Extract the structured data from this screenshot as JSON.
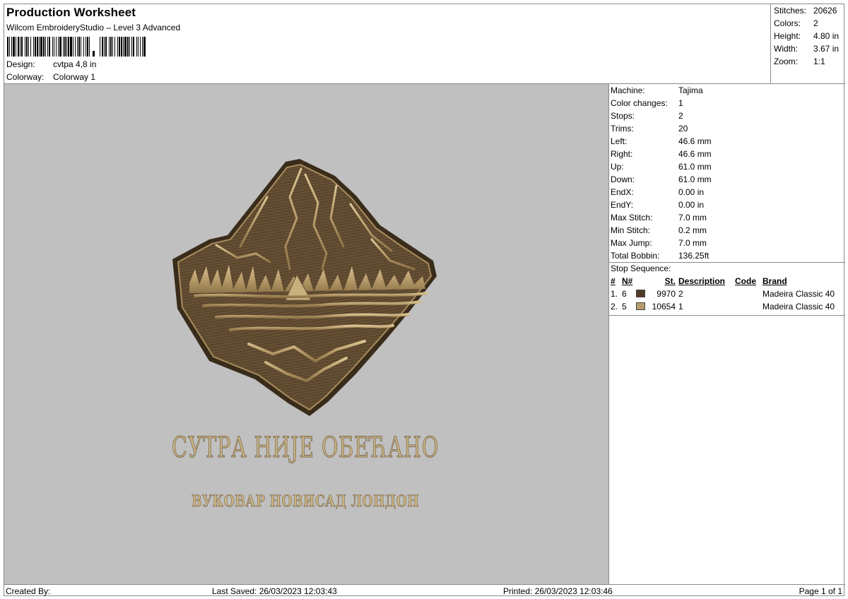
{
  "header": {
    "title": "Production Worksheet",
    "software": "Wilcom EmbroideryStudio – Level 3 Advanced",
    "design_label": "Design:",
    "design_value": "cvtpa 4,8 in",
    "colorway_label": "Colorway:",
    "colorway_value": "Colorway 1"
  },
  "stats": [
    {
      "label": "Stitches:",
      "value": "20626"
    },
    {
      "label": "Colors:",
      "value": "2"
    },
    {
      "label": "Height:",
      "value": "4.80 in"
    },
    {
      "label": "Width:",
      "value": "3.67 in"
    },
    {
      "label": "Zoom:",
      "value": "1:1"
    }
  ],
  "machine_info": [
    {
      "label": "Machine:",
      "value": "Tajima"
    },
    {
      "label": "Color changes:",
      "value": "1"
    },
    {
      "label": "Stops:",
      "value": "2"
    },
    {
      "label": "Trims:",
      "value": "20"
    },
    {
      "label": "Left:",
      "value": "46.6 mm"
    },
    {
      "label": "Right:",
      "value": "46.6 mm"
    },
    {
      "label": "Up:",
      "value": "61.0 mm"
    },
    {
      "label": "Down:",
      "value": "61.0 mm"
    },
    {
      "label": "EndX:",
      "value": "0.00 in"
    },
    {
      "label": "EndY:",
      "value": "0.00 in"
    },
    {
      "label": "Max Stitch:",
      "value": "7.0 mm"
    },
    {
      "label": "Min Stitch:",
      "value": "0.2 mm"
    },
    {
      "label": "Max Jump:",
      "value": "7.0 mm"
    },
    {
      "label": "Total Bobbin:",
      "value": "136.25ft"
    }
  ],
  "stop_sequence": {
    "label": "Stop Sequence:",
    "columns": [
      "#",
      "N#",
      "St.",
      "Description",
      "Code",
      "Brand"
    ],
    "rows": [
      {
        "index": "1.",
        "needle": "6",
        "color": "#4f3c27",
        "stitches": "9970",
        "description": "2",
        "code": "",
        "brand": "Madeira Classic 40"
      },
      {
        "index": "2.",
        "needle": "5",
        "color": "#b89c6c",
        "stitches": "10654",
        "description": "1",
        "code": "",
        "brand": "Madeira Classic 40"
      }
    ]
  },
  "design_text": {
    "line1": "СУТРА НИЈЕ ОБЕЋАНО",
    "line2": "ВУКОВАР НОВИСАД ЛОНДОН"
  },
  "footer": {
    "created_by": "Created By:",
    "last_saved": "Last Saved: 26/03/2023 12:03:43",
    "printed": "Printed: 26/03/2023 12:03:46",
    "page": "Page 1 of 1"
  },
  "colors": {
    "background": "#c0c0c0",
    "thread_dark": "#4f3c27",
    "thread_light": "#b89c6c",
    "border": "#8a8a8a"
  }
}
